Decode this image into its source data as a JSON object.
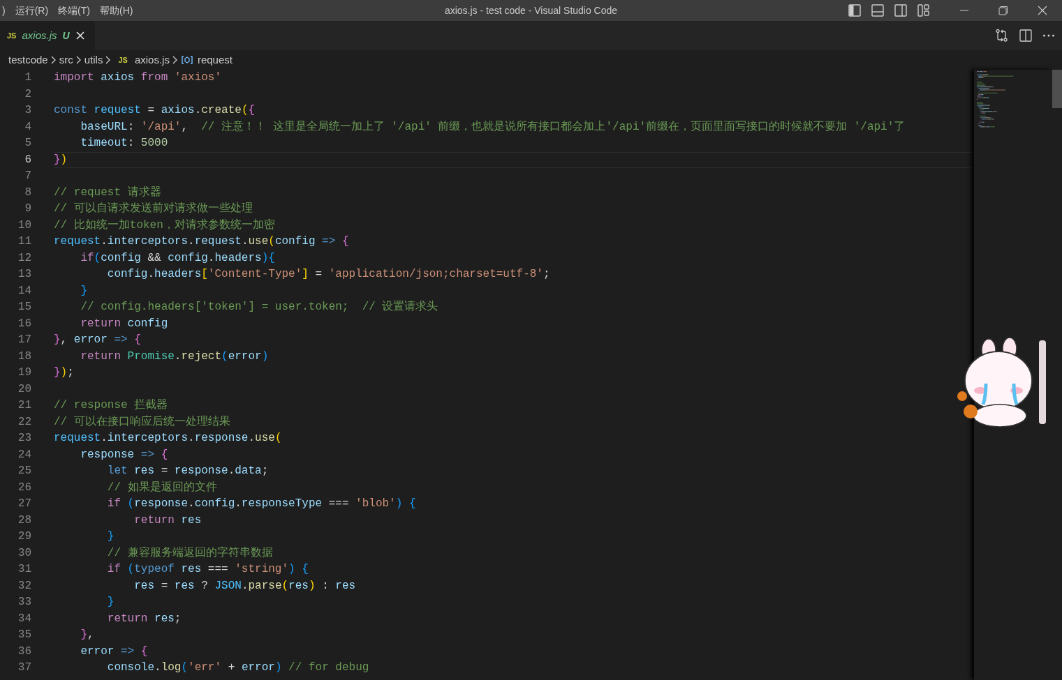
{
  "title_bar": {
    "menu": [
      ")",
      "运行(R)",
      "终端(T)",
      "帮助(H)"
    ],
    "title": "axios.js - test code - Visual Studio Code"
  },
  "tabs": [
    {
      "icon_text": "JS",
      "label": "axios.js",
      "status": "U",
      "selected": true,
      "preview": true
    }
  ],
  "breadcrumb": [
    {
      "kind": "folder",
      "label": "testcode"
    },
    {
      "kind": "folder",
      "label": "src"
    },
    {
      "kind": "folder",
      "label": "utils"
    },
    {
      "kind": "file",
      "icon_text": "JS",
      "label": "axios.js"
    },
    {
      "kind": "symbol",
      "label": "request"
    }
  ],
  "editor": {
    "lines": [
      {
        "number": "1",
        "current": false,
        "tokens": [
          {
            "text": "import",
            "kind": "kw"
          },
          {
            "text": " axios ",
            "kind": "var"
          },
          {
            "text": "from",
            "kind": "kw"
          },
          {
            "text": " 'axios'",
            "kind": "str"
          }
        ]
      },
      {
        "number": "2",
        "current": false
      },
      {
        "number": "3",
        "current": false,
        "tokens": [
          {
            "text": "const",
            "kind": "st"
          },
          {
            "text": " request",
            "kind": "cv"
          },
          {
            "text": " = ",
            "kind": "p"
          },
          {
            "text": "axios",
            "kind": "var"
          },
          {
            "text": ".",
            "kind": "p"
          },
          {
            "text": "create",
            "kind": "fn"
          },
          {
            "text": "(",
            "kind": "b1"
          },
          {
            "text": "{",
            "kind": "b2"
          }
        ]
      },
      {
        "number": "4",
        "current": false,
        "tokens": [
          {
            "text": "    baseURL",
            "kind": "var"
          },
          {
            "text": ": ",
            "kind": "p"
          },
          {
            "text": "'/api'",
            "kind": "str"
          },
          {
            "text": ",  ",
            "kind": "p"
          },
          {
            "text": "// 注意！！ 这里是全局统一加上了 '/api' 前缀，也就是说所有接口都会加上'/api'前缀在，页面里面写接口的时候就不要加 '/api'了",
            "kind": "cm"
          }
        ]
      },
      {
        "number": "5",
        "current": false,
        "tokens": [
          {
            "text": "    timeout",
            "kind": "var"
          },
          {
            "text": ": ",
            "kind": "p"
          },
          {
            "text": "5000",
            "kind": "num"
          }
        ]
      },
      {
        "number": "6",
        "current": true,
        "tokens": [
          {
            "text": "}",
            "kind": "b2"
          },
          {
            "text": ")",
            "kind": "b1"
          }
        ]
      },
      {
        "number": "7",
        "current": false
      },
      {
        "number": "8",
        "current": false,
        "tokens": [
          {
            "text": "// request 请求器",
            "kind": "cm"
          }
        ]
      },
      {
        "number": "9",
        "current": false,
        "tokens": [
          {
            "text": "// 可以自请求发送前对请求做一些处理",
            "kind": "cm"
          }
        ]
      },
      {
        "number": "10",
        "current": false,
        "tokens": [
          {
            "text": "// 比如统一加token，对请求参数统一加密",
            "kind": "cm"
          }
        ]
      },
      {
        "number": "11",
        "current": false,
        "tokens": [
          {
            "text": "request",
            "kind": "cv"
          },
          {
            "text": ".",
            "kind": "p"
          },
          {
            "text": "interceptors",
            "kind": "var"
          },
          {
            "text": ".",
            "kind": "p"
          },
          {
            "text": "request",
            "kind": "var"
          },
          {
            "text": ".",
            "kind": "p"
          },
          {
            "text": "use",
            "kind": "fn"
          },
          {
            "text": "(",
            "kind": "b1"
          },
          {
            "text": "config",
            "kind": "var"
          },
          {
            "text": " => ",
            "kind": "st"
          },
          {
            "text": "{",
            "kind": "b2"
          }
        ]
      },
      {
        "number": "12",
        "current": false,
        "tokens": [
          {
            "text": "    if",
            "kind": "kw"
          },
          {
            "text": "(",
            "kind": "b3"
          },
          {
            "text": "config",
            "kind": "var"
          },
          {
            "text": " && ",
            "kind": "p"
          },
          {
            "text": "config",
            "kind": "var"
          },
          {
            "text": ".",
            "kind": "p"
          },
          {
            "text": "headers",
            "kind": "var"
          },
          {
            "text": ")",
            "kind": "b3"
          },
          {
            "text": "{",
            "kind": "b3"
          }
        ]
      },
      {
        "number": "13",
        "current": false,
        "tokens": [
          {
            "text": "        config",
            "kind": "var"
          },
          {
            "text": ".",
            "kind": "p"
          },
          {
            "text": "headers",
            "kind": "var"
          },
          {
            "text": "[",
            "kind": "b1"
          },
          {
            "text": "'Content-Type'",
            "kind": "str"
          },
          {
            "text": "]",
            "kind": "b1"
          },
          {
            "text": " = ",
            "kind": "p"
          },
          {
            "text": "'application/json;charset=utf-8'",
            "kind": "str"
          },
          {
            "text": ";",
            "kind": "p"
          }
        ]
      },
      {
        "number": "14",
        "current": false,
        "tokens": [
          {
            "text": "    }",
            "kind": "b3"
          }
        ]
      },
      {
        "number": "15",
        "current": false,
        "tokens": [
          {
            "text": "    // config.headers['token'] = user.token;  // 设置请求头",
            "kind": "cm"
          }
        ]
      },
      {
        "number": "16",
        "current": false,
        "tokens": [
          {
            "text": "    return",
            "kind": "kw"
          },
          {
            "text": " config",
            "kind": "var"
          }
        ]
      },
      {
        "number": "17",
        "current": false,
        "tokens": [
          {
            "text": "}",
            "kind": "b2"
          },
          {
            "text": ", ",
            "kind": "p"
          },
          {
            "text": "error",
            "kind": "var"
          },
          {
            "text": " => ",
            "kind": "st"
          },
          {
            "text": "{",
            "kind": "b2"
          }
        ]
      },
      {
        "number": "18",
        "current": false,
        "tokens": [
          {
            "text": "    return",
            "kind": "kw"
          },
          {
            "text": " Promise",
            "kind": "cls"
          },
          {
            "text": ".",
            "kind": "p"
          },
          {
            "text": "reject",
            "kind": "fn"
          },
          {
            "text": "(",
            "kind": "b3"
          },
          {
            "text": "error",
            "kind": "var"
          },
          {
            "text": ")",
            "kind": "b3"
          }
        ]
      },
      {
        "number": "19",
        "current": false,
        "tokens": [
          {
            "text": "}",
            "kind": "b2"
          },
          {
            "text": ")",
            "kind": "b1"
          },
          {
            "text": ";",
            "kind": "p"
          }
        ]
      },
      {
        "number": "20",
        "current": false
      },
      {
        "number": "21",
        "current": false,
        "tokens": [
          {
            "text": "// response 拦截器",
            "kind": "cm"
          }
        ]
      },
      {
        "number": "22",
        "current": false,
        "tokens": [
          {
            "text": "// 可以在接口响应后统一处理结果",
            "kind": "cm"
          }
        ]
      },
      {
        "number": "23",
        "current": false,
        "tokens": [
          {
            "text": "request",
            "kind": "cv"
          },
          {
            "text": ".",
            "kind": "p"
          },
          {
            "text": "interceptors",
            "kind": "var"
          },
          {
            "text": ".",
            "kind": "p"
          },
          {
            "text": "response",
            "kind": "var"
          },
          {
            "text": ".",
            "kind": "p"
          },
          {
            "text": "use",
            "kind": "fn"
          },
          {
            "text": "(",
            "kind": "b1"
          }
        ]
      },
      {
        "number": "24",
        "current": false,
        "tokens": [
          {
            "text": "    response",
            "kind": "var"
          },
          {
            "text": " => ",
            "kind": "st"
          },
          {
            "text": "{",
            "kind": "b2"
          }
        ]
      },
      {
        "number": "25",
        "current": false,
        "tokens": [
          {
            "text": "        let",
            "kind": "st"
          },
          {
            "text": " res",
            "kind": "var"
          },
          {
            "text": " = ",
            "kind": "p"
          },
          {
            "text": "response",
            "kind": "var"
          },
          {
            "text": ".",
            "kind": "p"
          },
          {
            "text": "data",
            "kind": "var"
          },
          {
            "text": ";",
            "kind": "p"
          }
        ]
      },
      {
        "number": "26",
        "current": false,
        "tokens": [
          {
            "text": "        // 如果是返回的文件",
            "kind": "cm"
          }
        ]
      },
      {
        "number": "27",
        "current": false,
        "tokens": [
          {
            "text": "        if",
            "kind": "kw"
          },
          {
            "text": " (",
            "kind": "b3"
          },
          {
            "text": "response",
            "kind": "var"
          },
          {
            "text": ".",
            "kind": "p"
          },
          {
            "text": "config",
            "kind": "var"
          },
          {
            "text": ".",
            "kind": "p"
          },
          {
            "text": "responseType",
            "kind": "var"
          },
          {
            "text": " === ",
            "kind": "p"
          },
          {
            "text": "'blob'",
            "kind": "str"
          },
          {
            "text": ")",
            "kind": "b3"
          },
          {
            "text": " {",
            "kind": "b3"
          }
        ]
      },
      {
        "number": "28",
        "current": false,
        "tokens": [
          {
            "text": "            return",
            "kind": "kw"
          },
          {
            "text": " res",
            "kind": "var"
          }
        ]
      },
      {
        "number": "29",
        "current": false,
        "tokens": [
          {
            "text": "        }",
            "kind": "b3"
          }
        ]
      },
      {
        "number": "30",
        "current": false,
        "tokens": [
          {
            "text": "        // 兼容服务端返回的字符串数据",
            "kind": "cm"
          }
        ]
      },
      {
        "number": "31",
        "current": false,
        "tokens": [
          {
            "text": "        if",
            "kind": "kw"
          },
          {
            "text": " (",
            "kind": "b3"
          },
          {
            "text": "typeof",
            "kind": "st"
          },
          {
            "text": " res",
            "kind": "var"
          },
          {
            "text": " === ",
            "kind": "p"
          },
          {
            "text": "'string'",
            "kind": "str"
          },
          {
            "text": ")",
            "kind": "b3"
          },
          {
            "text": " {",
            "kind": "b3"
          }
        ]
      },
      {
        "number": "32",
        "current": false,
        "tokens": [
          {
            "text": "            res",
            "kind": "var"
          },
          {
            "text": " = ",
            "kind": "p"
          },
          {
            "text": "res",
            "kind": "var"
          },
          {
            "text": " ? ",
            "kind": "p"
          },
          {
            "text": "JSON",
            "kind": "cv"
          },
          {
            "text": ".",
            "kind": "p"
          },
          {
            "text": "parse",
            "kind": "fn"
          },
          {
            "text": "(",
            "kind": "b1"
          },
          {
            "text": "res",
            "kind": "var"
          },
          {
            "text": ")",
            "kind": "b1"
          },
          {
            "text": " : ",
            "kind": "p"
          },
          {
            "text": "res",
            "kind": "var"
          }
        ]
      },
      {
        "number": "33",
        "current": false,
        "tokens": [
          {
            "text": "        }",
            "kind": "b3"
          }
        ]
      },
      {
        "number": "34",
        "current": false,
        "tokens": [
          {
            "text": "        return",
            "kind": "kw"
          },
          {
            "text": " res",
            "kind": "var"
          },
          {
            "text": ";",
            "kind": "p"
          }
        ]
      },
      {
        "number": "35",
        "current": false,
        "tokens": [
          {
            "text": "    }",
            "kind": "b2"
          },
          {
            "text": ",",
            "kind": "p"
          }
        ]
      },
      {
        "number": "36",
        "current": false,
        "tokens": [
          {
            "text": "    error",
            "kind": "var"
          },
          {
            "text": " => ",
            "kind": "st"
          },
          {
            "text": "{",
            "kind": "b2"
          }
        ]
      },
      {
        "number": "37",
        "current": false,
        "tokens": [
          {
            "text": "        console",
            "kind": "var"
          },
          {
            "text": ".",
            "kind": "p"
          },
          {
            "text": "log",
            "kind": "fn"
          },
          {
            "text": "(",
            "kind": "b3"
          },
          {
            "text": "'err'",
            "kind": "str"
          },
          {
            "text": " + ",
            "kind": "p"
          },
          {
            "text": "error",
            "kind": "var"
          },
          {
            "text": ")",
            "kind": "b3"
          },
          {
            "text": " // for debug",
            "kind": "cm"
          }
        ]
      }
    ]
  }
}
